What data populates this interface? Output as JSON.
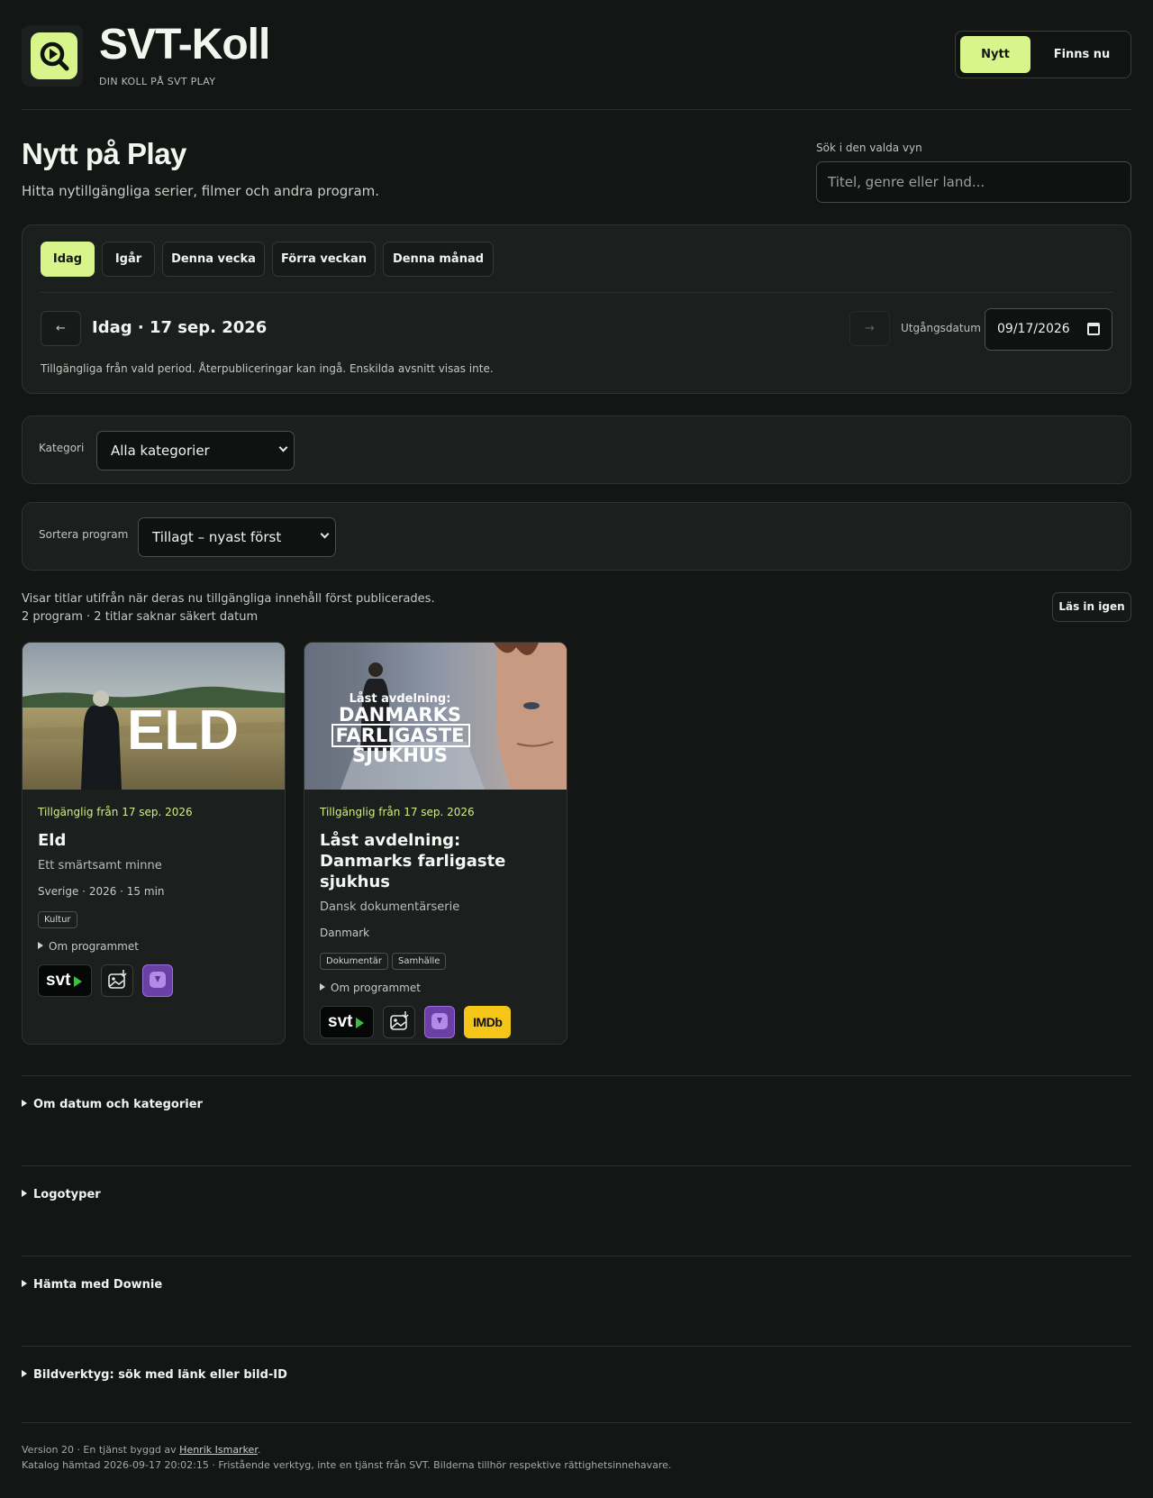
{
  "brand": {
    "title": "SVT-Koll",
    "subtitle": "DIN KOLL PÅ SVT PLAY"
  },
  "nav": {
    "items": [
      {
        "label": "Nytt",
        "active": true
      },
      {
        "label": "Finns nu",
        "active": false
      }
    ]
  },
  "heading": {
    "title": "Nytt på Play",
    "lede": "Hitta nytillgängliga serier, filmer och andra program."
  },
  "search": {
    "label": "Sök i den valda vyn",
    "placeholder": "Titel, genre eller land..."
  },
  "period": {
    "tabs": [
      {
        "label": "Idag",
        "active": true
      },
      {
        "label": "Igår",
        "active": false
      },
      {
        "label": "Denna vecka",
        "active": false
      },
      {
        "label": "Förra veckan",
        "active": false
      },
      {
        "label": "Denna månad",
        "active": false
      }
    ],
    "prev_label": "←",
    "next_label": "→",
    "current": "Idag · 17 sep. 2026",
    "expiry_label": "Utgångsdatum",
    "expiry_value": "09/17/2026",
    "note": "Tillgängliga från vald period. Återpubliceringar kan ingå. Enskilda avsnitt visas inte."
  },
  "category": {
    "label": "Kategori",
    "selected": "Alla kategorier"
  },
  "sort": {
    "label": "Sortera program",
    "selected": "Tillagt – nyast först"
  },
  "results": {
    "info": "Visar titlar utifrån när deras nu tillgängliga innehåll först publicerades.",
    "count": "2 program · 2 titlar saknar säkert datum",
    "reload_label": "Läs in igen"
  },
  "cards": [
    {
      "thumb_text": "ELD",
      "available": "Tillgänglig från 17 sep. 2026",
      "title": "Eld",
      "subtitle": "Ett smärtsamt minne",
      "meta": "Sverige · 2026 · 15 min",
      "tags": [
        "Kultur"
      ],
      "about": "Om programmet",
      "links": [
        "svt",
        "image-search",
        "downie"
      ]
    },
    {
      "thumb_text": [
        "Låst avdelning:",
        "DANMARKS",
        "FARLIGASTE",
        "SJUKHUS"
      ],
      "available": "Tillgänglig från 17 sep. 2026",
      "title": "Låst avdelning: Danmarks farligaste sjukhus",
      "subtitle": "Dansk dokumentärserie",
      "meta": "Danmark",
      "tags": [
        "Dokumentär",
        "Samhälle"
      ],
      "about": "Om programmet",
      "links": [
        "svt",
        "image-search",
        "downie",
        "imdb"
      ],
      "imdb_label": "IMDb"
    }
  ],
  "link_labels": {
    "svt": "svt"
  },
  "accordions": [
    "Om datum och kategorier",
    "Logotyper",
    "Hämta med Downie",
    "Bildverktyg: sök med länk eller bild-ID"
  ],
  "footer": {
    "line1_prefix": "Version 20 · En tjänst byggd av ",
    "author": "Henrik Ismarker",
    "line1_suffix": ".",
    "line2": "Katalog hämtad 2026-09-17 20:02:15 · Fristående verktyg, inte en tjänst från SVT. Bilderna tillhör respektive rättighetsinnehavare."
  },
  "colors": {
    "accent": "#d7f58b",
    "background": "#131615",
    "panel": "#1b1f1e",
    "imdb": "#f5c518",
    "downie": "#6b3fa6"
  }
}
